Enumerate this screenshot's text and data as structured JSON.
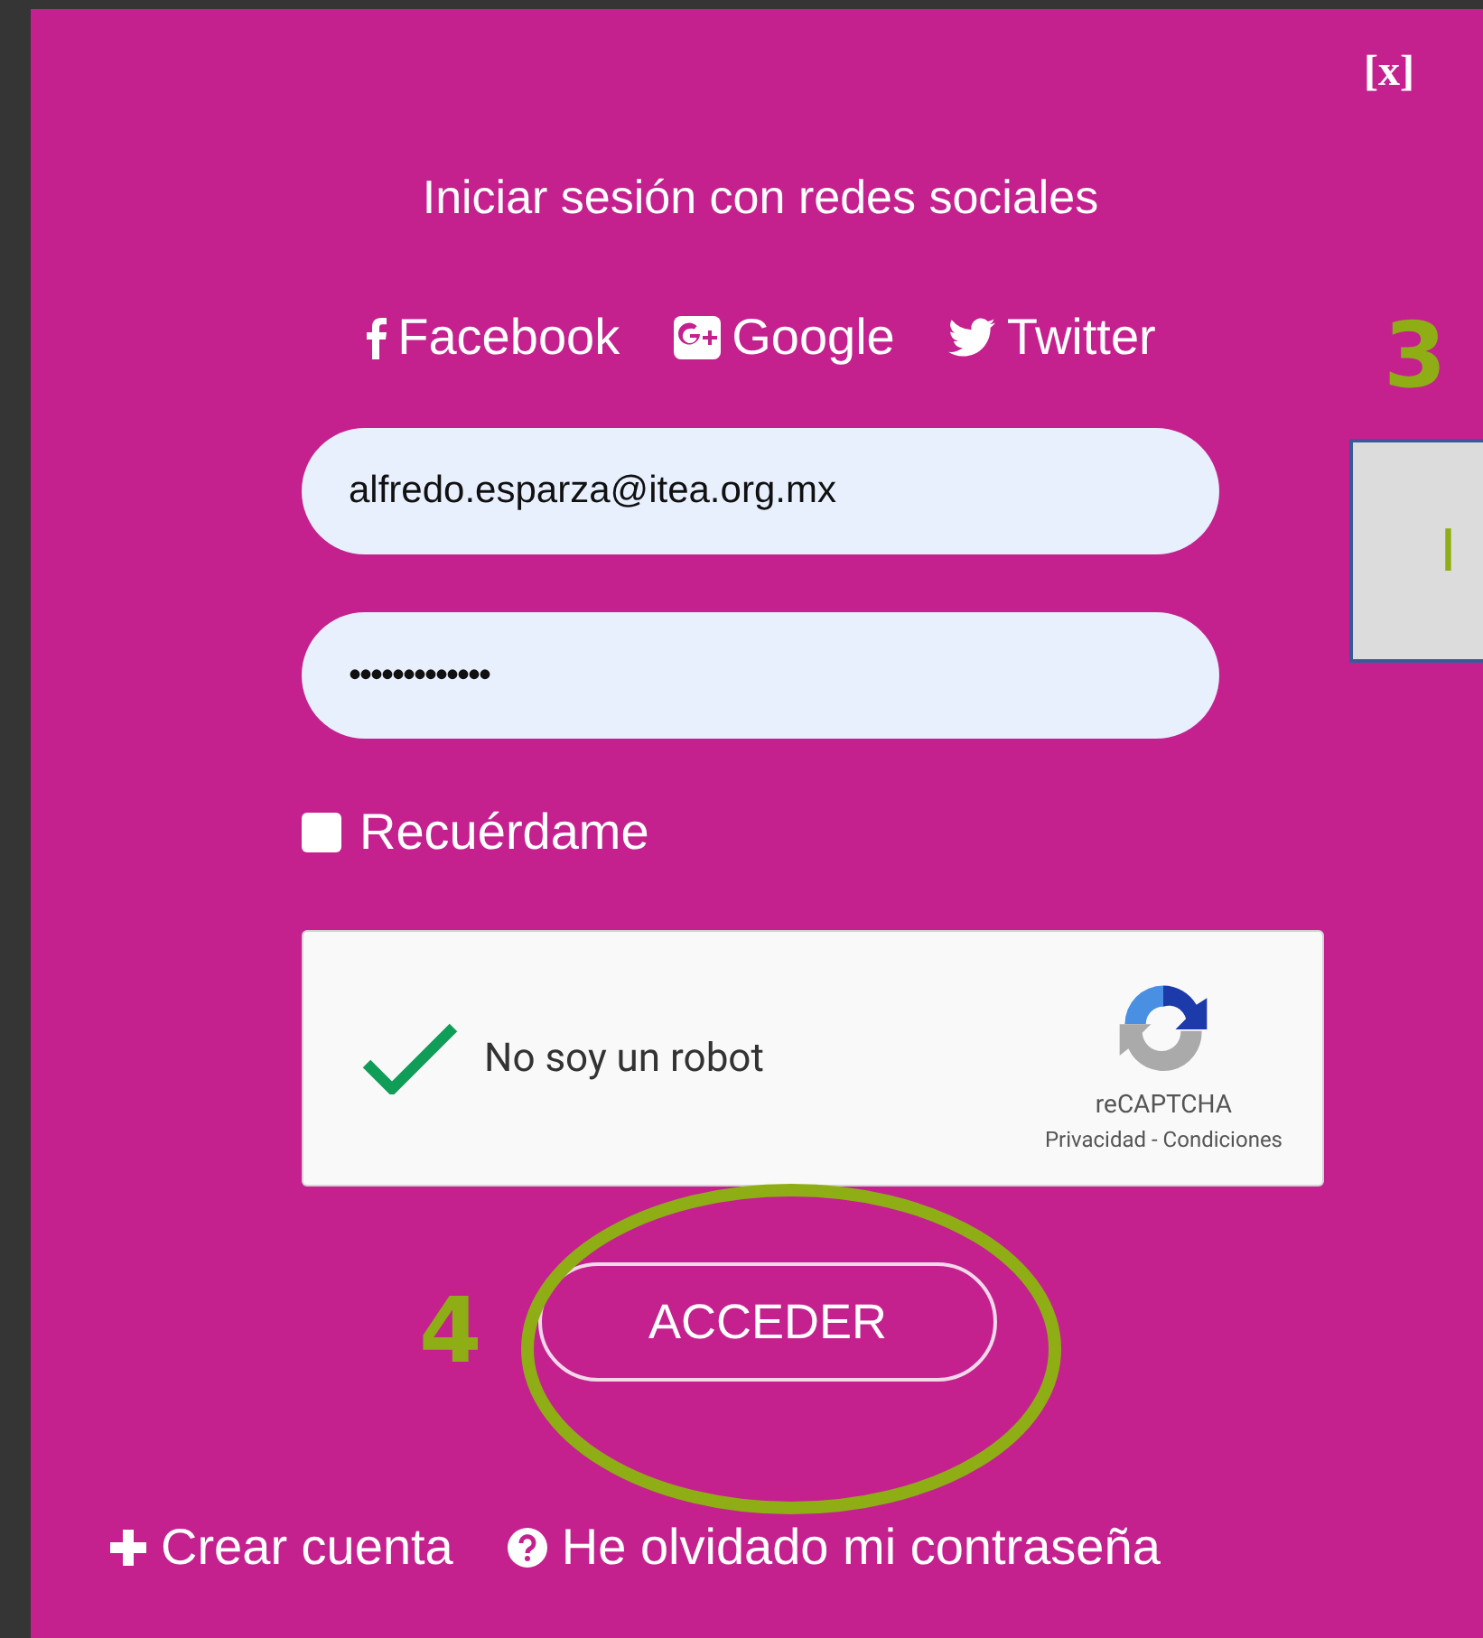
{
  "close": "[x]",
  "title": "Iniciar sesión con redes sociales",
  "social": [
    {
      "kind": "facebook",
      "label": "Facebook"
    },
    {
      "kind": "google",
      "label": "Google"
    },
    {
      "kind": "twitter",
      "label": "Twitter"
    }
  ],
  "email": {
    "value": "alfredo.esparza@itea.org.mx"
  },
  "password": {
    "value": "•••••••••••••"
  },
  "remember": {
    "label": "Recuérdame",
    "checked": false
  },
  "captcha": {
    "label": "No soy un robot",
    "checked": true,
    "brand": "reCAPTCHA",
    "links": "Privacidad - Condiciones"
  },
  "submit": "ACCEDER",
  "links": [
    {
      "kind": "plus",
      "label": "Crear cuenta"
    },
    {
      "kind": "question",
      "label": "He olvidado mi contraseña"
    }
  ],
  "background_button": {
    "label": "I"
  },
  "annotations": [
    {
      "kind": "number",
      "label": "3"
    },
    {
      "kind": "number",
      "label": "4"
    },
    {
      "kind": "ellipse"
    }
  ]
}
